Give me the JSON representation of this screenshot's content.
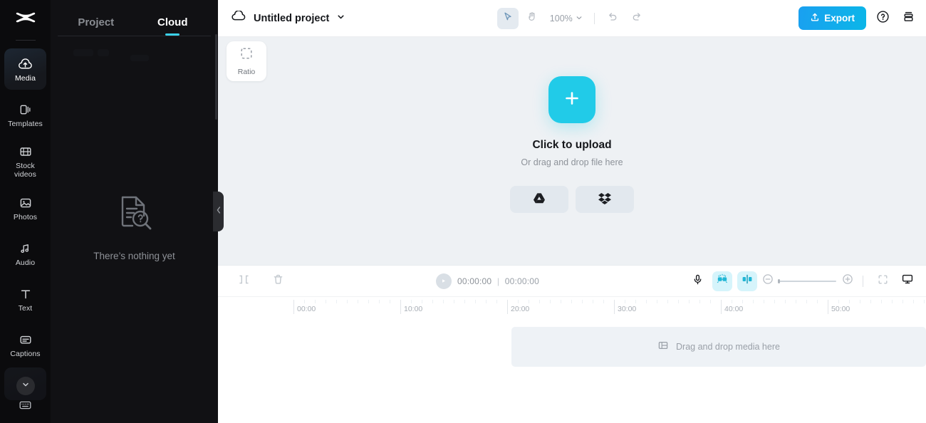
{
  "app": {
    "brand": "capcut-logo"
  },
  "rail": {
    "items": [
      {
        "label": "Media",
        "icon": "cloud-upload-icon",
        "active": true
      },
      {
        "label": "Templates",
        "icon": "templates-icon",
        "active": false
      },
      {
        "label": "Stock\nvideos",
        "label_line1": "Stock",
        "label_line2": "videos",
        "icon": "film-strip-icon",
        "active": false
      },
      {
        "label": "Photos",
        "icon": "image-icon",
        "active": false
      },
      {
        "label": "Audio",
        "icon": "music-note-icon",
        "active": false
      },
      {
        "label": "Text",
        "icon": "text-t-icon",
        "active": false
      },
      {
        "label": "Captions",
        "icon": "captions-icon",
        "active": false
      }
    ],
    "more_label": "chevron-down-icon",
    "bottom_icon": "keyboard-shortcuts-icon"
  },
  "panel": {
    "tabs": [
      {
        "label": "Project",
        "active": false
      },
      {
        "label": "Cloud",
        "active": true
      }
    ],
    "empty_label": "There’s nothing yet",
    "empty_icon": "document-search-icon",
    "collapse_icon": "chevron-left-icon"
  },
  "topbar": {
    "cloud_icon": "cloud-icon",
    "project_title": "Untitled project",
    "title_caret": "chevron-down-icon",
    "tools": [
      {
        "name": "select-tool",
        "icon": "cursor-arrow-icon",
        "selected": true
      },
      {
        "name": "hand-tool",
        "icon": "hand-icon",
        "selected": false
      }
    ],
    "zoom_value": "100%",
    "zoom_caret": "chevron-down-icon",
    "undo_icon": "undo-icon",
    "redo_icon": "redo-icon",
    "export_label": "Export",
    "export_icon": "upload-icon",
    "help_icon": "help-circle-icon",
    "layout_icon": "layout-stack-icon"
  },
  "stage": {
    "ratio_label": "Ratio",
    "ratio_icon": "crop-dashed-icon",
    "upload_plus_icon": "plus-icon",
    "upload_title": "Click to upload",
    "upload_subtitle": "Or drag and drop file here",
    "cloud_sources": [
      {
        "name": "google-drive",
        "icon": "google-drive-icon"
      },
      {
        "name": "dropbox",
        "icon": "dropbox-icon"
      }
    ]
  },
  "timeline": {
    "tools": [
      {
        "name": "split-clip-button",
        "icon": "split-icon"
      },
      {
        "name": "delete-clip-button",
        "icon": "trash-icon"
      }
    ],
    "play_icon": "play-icon",
    "current_time": "00:00:00",
    "time_separator": "|",
    "total_time": "00:00:00",
    "right_tools": [
      {
        "name": "record-voiceover-button",
        "icon": "microphone-icon",
        "highlighted": false
      },
      {
        "name": "auto-enhance-button",
        "icon": "magic-audio-icon",
        "highlighted": true
      },
      {
        "name": "split-align-button",
        "icon": "align-split-icon",
        "highlighted": true
      }
    ],
    "zoom_out_icon": "minus-circle-icon",
    "zoom_in_icon": "plus-circle-icon",
    "fit_icon": "fit-screen-icon",
    "preview_icon": "monitor-icon",
    "ruler_labels": [
      "00:00",
      "10:00",
      "20:00",
      "30:00",
      "40:00",
      "50:00"
    ],
    "ruler_major_x": [
      412,
      562,
      712,
      862,
      1012,
      1162
    ],
    "drop_label": "Drag and drop media here",
    "drop_icon": "film-strip-icon"
  }
}
